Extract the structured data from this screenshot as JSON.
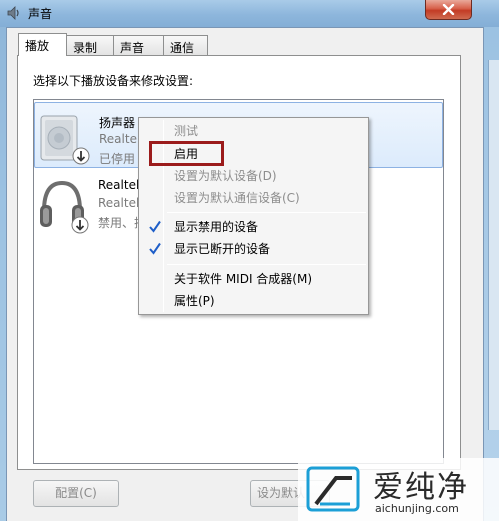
{
  "window": {
    "title": "声音"
  },
  "tabs": [
    {
      "label": "播放",
      "active": true
    },
    {
      "label": "录制",
      "active": false
    },
    {
      "label": "声音",
      "active": false
    },
    {
      "label": "通信",
      "active": false
    }
  ],
  "panel": {
    "instruction": "选择以下播放设备来修改设置:"
  },
  "devices": [
    {
      "name": "扬声器",
      "line2": "Realtek",
      "line3": "已停用",
      "icon": "speaker-icon",
      "selected": true
    },
    {
      "name": "Realtek",
      "line2": "Realtek",
      "line3": "禁用、技",
      "icon": "headphones-icon",
      "selected": false
    }
  ],
  "context_menu": {
    "items": [
      {
        "label": "测试",
        "enabled": false
      },
      {
        "label": "启用",
        "enabled": true,
        "highlighted_box": true
      },
      {
        "label": "设置为默认设备(D)",
        "enabled": false
      },
      {
        "label": "设置为默认通信设备(C)",
        "enabled": false
      },
      {
        "label": "显示禁用的设备",
        "checked": true
      },
      {
        "label": "显示已断开的设备",
        "checked": true
      },
      {
        "label": "关于软件 MIDI 合成器(M)",
        "enabled": true
      },
      {
        "label": "属性(P)",
        "enabled": true
      }
    ]
  },
  "buttons": {
    "configure": "配置(C)",
    "set_default": "设为默认"
  },
  "watermark": {
    "title": "爱纯净",
    "url": "aichunjing.com"
  },
  "colors": {
    "highlight_border": "#9b1b1b",
    "checkmark": "#1e5ec8",
    "close_red": "#c23b25"
  }
}
